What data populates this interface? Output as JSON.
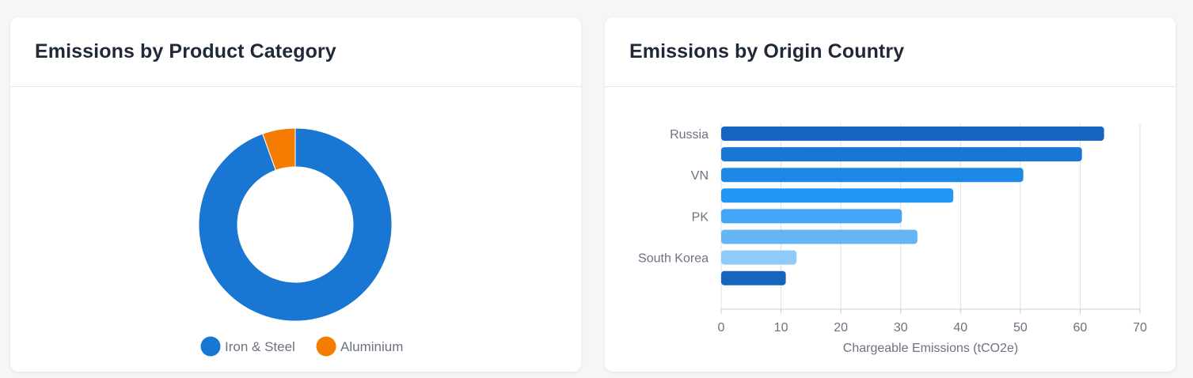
{
  "cards": {
    "left_title": "Emissions by Product Category",
    "right_title": "Emissions by Origin Country"
  },
  "chart_data": [
    {
      "type": "pie",
      "title": "Emissions by Product Category",
      "categories": [
        "Iron & Steel",
        "Aluminium"
      ],
      "values": [
        94.5,
        5.5
      ],
      "colors": [
        "#1976d2",
        "#f57c00"
      ],
      "legend_position": "bottom"
    },
    {
      "type": "bar",
      "orientation": "horizontal",
      "title": "Emissions by Origin Country",
      "categories": [
        "Russia",
        "",
        "VN",
        "",
        "PK",
        "",
        "South Korea",
        ""
      ],
      "values": [
        64,
        60.3,
        50.5,
        38.8,
        30.2,
        32.8,
        12.6,
        10.8
      ],
      "colors": [
        "#1565c0",
        "#1976d2",
        "#1e88e5",
        "#2196f3",
        "#42a5f5",
        "#64b5f6",
        "#90caf9",
        "#1565c0"
      ],
      "xlabel": "Chargeable Emissions (tCO2e)",
      "xlim": [
        0,
        70
      ],
      "xticks": [
        0,
        10,
        20,
        30,
        40,
        50,
        60,
        70
      ],
      "grid": true
    }
  ]
}
